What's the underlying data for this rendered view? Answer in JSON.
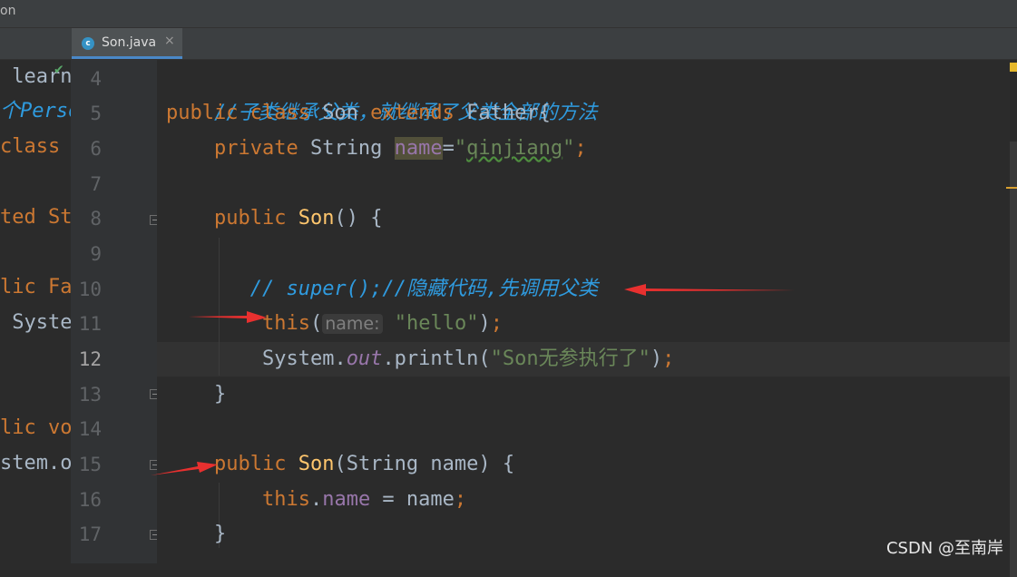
{
  "window": {
    "title_fragment": "on"
  },
  "tabs": [
    {
      "label": "Son.java",
      "icon": "java-class-icon",
      "close": "×"
    }
  ],
  "left_pane": [
    {
      "text": " learn",
      "color": "#a9b7c6"
    },
    {
      "text": "个Perso",
      "color": "#2f9bdf"
    },
    {
      "text": "class ",
      "color": "#cc7832"
    },
    {
      "text": "",
      "color": "#a9b7c6"
    },
    {
      "text": "ted St",
      "color": "#cc7832"
    },
    {
      "text": "",
      "color": "#a9b7c6"
    },
    {
      "text": "lic Fa",
      "color": "#cc7832"
    },
    {
      "text": " Syste",
      "color": "#a9b7c6"
    },
    {
      "text": "",
      "color": "#a9b7c6"
    },
    {
      "text": "",
      "color": "#a9b7c6"
    },
    {
      "text": "lic vo",
      "color": "#cc7832"
    },
    {
      "text": "stem.o",
      "color": "#a9b7c6"
    }
  ],
  "line_numbers": [
    "4",
    "5",
    "6",
    "7",
    "8",
    "9",
    "10",
    "11",
    "12",
    "13",
    "14",
    "15",
    "16",
    "17"
  ],
  "code": {
    "l4": "//子类继承父类，就继承了父类全部的方法",
    "l5": {
      "kw1": "public class ",
      "name": "Son ",
      "kw2": "extends ",
      "rest": "Father{"
    },
    "l6": {
      "kw": "private ",
      "type": "String ",
      "field": "name",
      "eq": "=",
      "q1": "\"",
      "val": "qinjiang",
      "q2": "\"",
      "semi": ";"
    },
    "l8": {
      "kw": "public ",
      "fn": "Son",
      "rest": "() {"
    },
    "l10": "// super();//隐藏代码,先调用父类",
    "l11": {
      "call": "this",
      "open": "(",
      "hint": "name:",
      "arg": " \"hello\"",
      "close": ")",
      "semi": ";"
    },
    "l12": {
      "pre": "System.",
      "out": "out",
      "mid": ".println(",
      "arg": "\"Son无参执行了\"",
      "close": ")",
      "semi": ";"
    },
    "l13": "}",
    "l15": {
      "kw": "public ",
      "fn": "Son",
      "rest": "(String name) {"
    },
    "l16": {
      "kw": "this",
      "dot": ".",
      "field": "name",
      "rest": " = name",
      "semi": ";"
    },
    "l17": "}"
  },
  "watermark": "CSDN @至南岸",
  "colors": {
    "keyword": "#cc7832",
    "comment": "#2f9bdf",
    "string": "#6a8759",
    "field": "#9876aa",
    "method": "#ffc66d",
    "annotation_arrow": "#e8302f"
  }
}
